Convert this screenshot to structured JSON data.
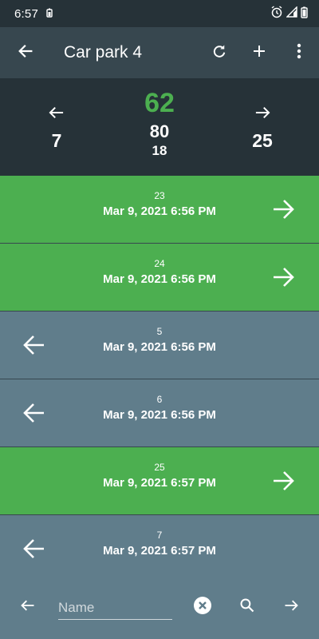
{
  "status_bar": {
    "time": "6:57"
  },
  "app_bar": {
    "title": "Car park 4"
  },
  "summary": {
    "entries_in": "7",
    "available": "62",
    "capacity": "80",
    "occupied": "18",
    "entries_out": "25",
    "available_color": "#4caf50"
  },
  "events": [
    {
      "direction": "in",
      "number": "23",
      "datetime": "Mar 9, 2021 6:56 PM"
    },
    {
      "direction": "in",
      "number": "24",
      "datetime": "Mar 9, 2021 6:56 PM"
    },
    {
      "direction": "out",
      "number": "5",
      "datetime": "Mar 9, 2021 6:56 PM"
    },
    {
      "direction": "out",
      "number": "6",
      "datetime": "Mar 9, 2021 6:56 PM"
    },
    {
      "direction": "in",
      "number": "25",
      "datetime": "Mar 9, 2021 6:57 PM"
    },
    {
      "direction": "out",
      "number": "7",
      "datetime": "Mar 9, 2021 6:57 PM"
    }
  ],
  "bottom_bar": {
    "name_placeholder": "Name"
  },
  "colors": {
    "in": "#4caf50",
    "out": "#607d8b",
    "header": "#37474f",
    "dark": "#263238"
  }
}
